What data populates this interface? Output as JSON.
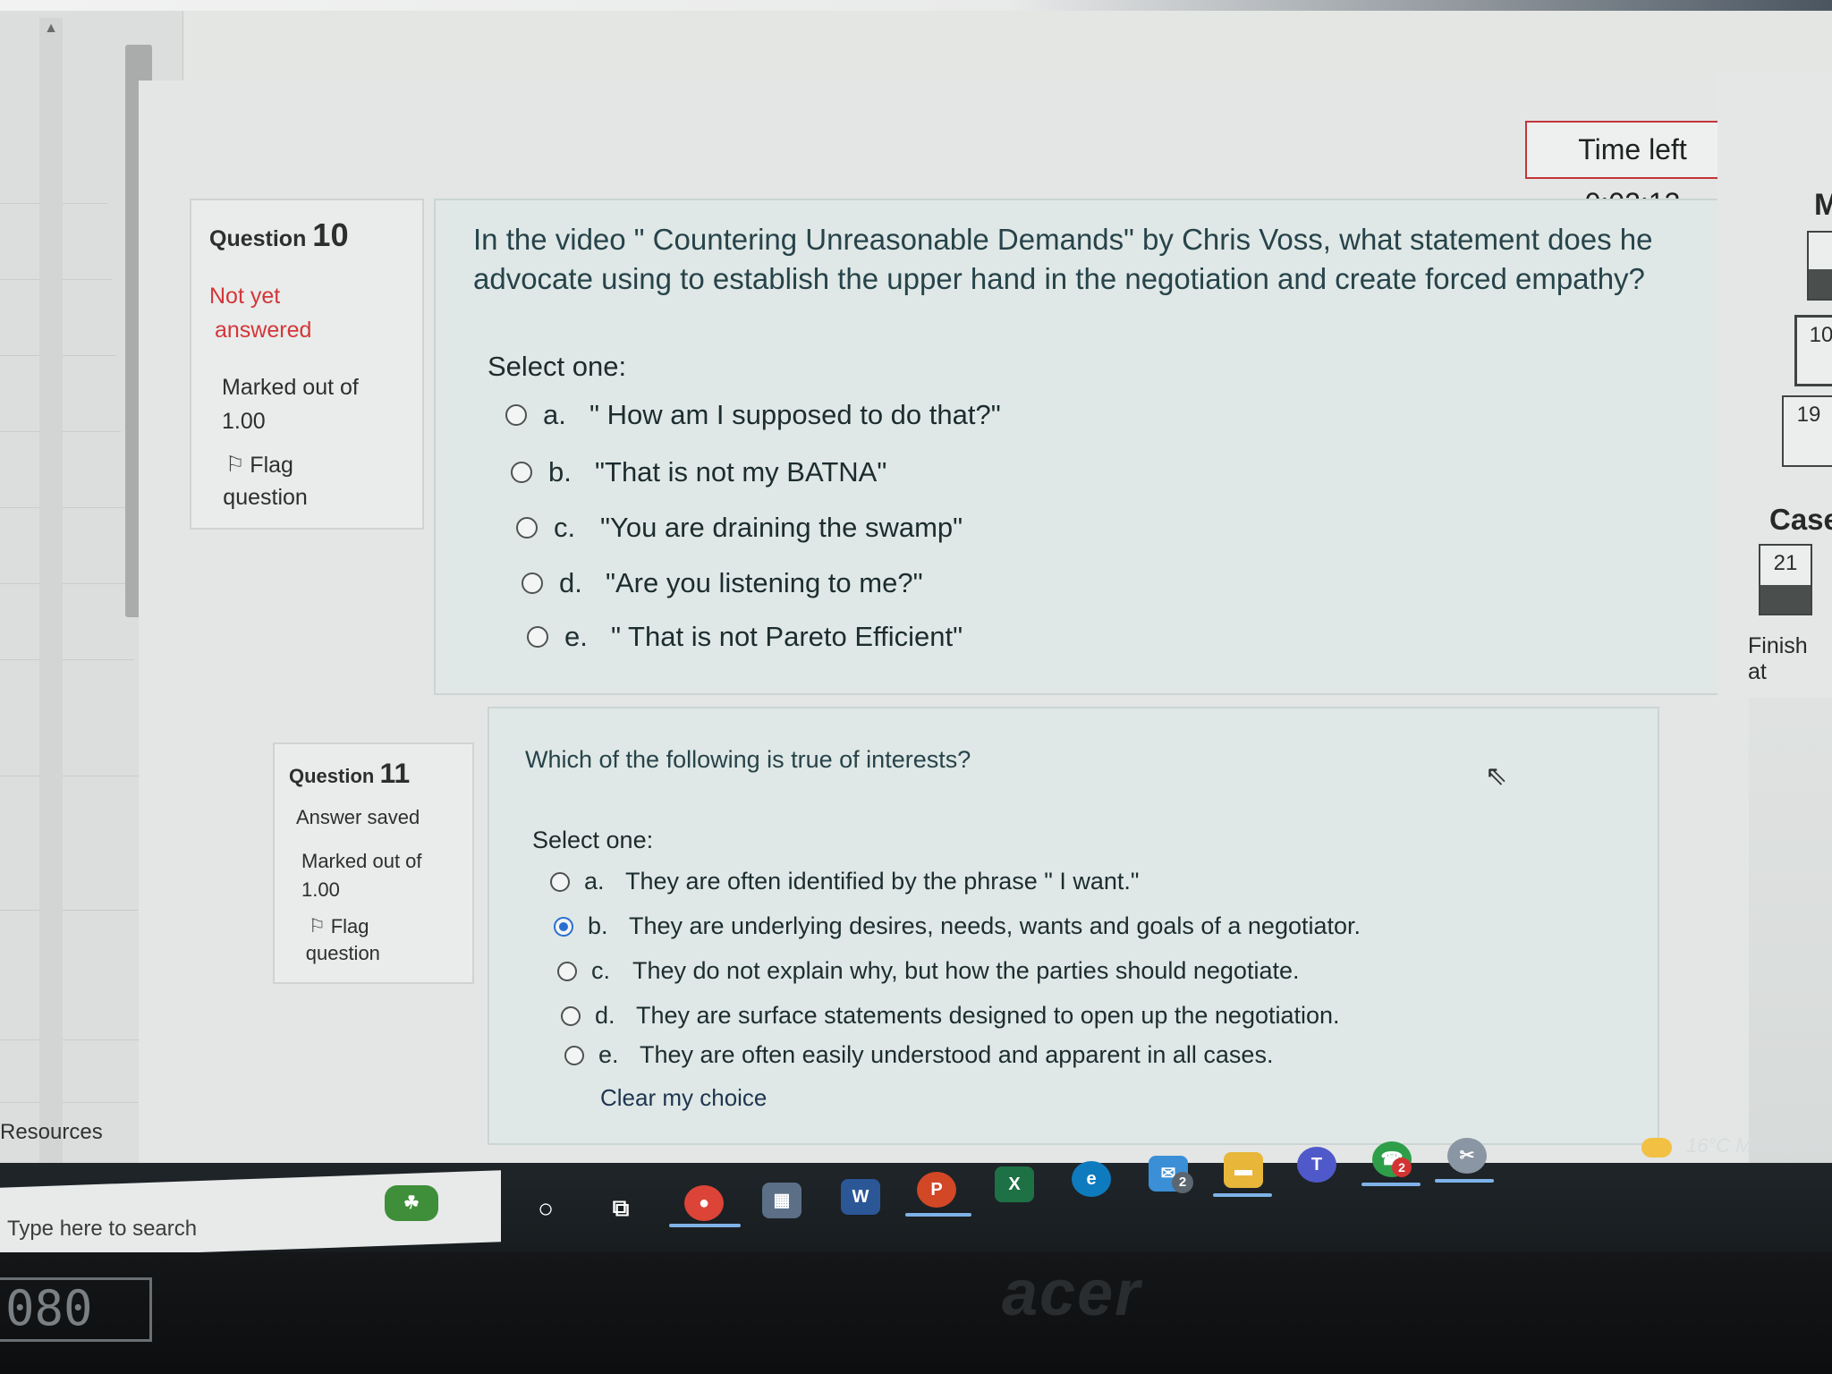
{
  "timer": {
    "label": "Time left 0:02:13"
  },
  "left_drawer": {
    "resources_label": "Resources"
  },
  "question10": {
    "title_prefix": "Question",
    "number": "10",
    "state_line1": "Not yet",
    "state_line2": "answered",
    "marked_line1": "Marked out of",
    "marked_line2": "1.00",
    "flag_line1": "Flag",
    "flag_line2": "question",
    "prompt": "In the video \" Countering Unreasonable Demands\" by Chris Voss, what statement does he advocate using to establish the upper hand in the negotiation and create forced empathy?",
    "select_label": "Select one:",
    "options": [
      {
        "letter": "a.",
        "text": "\" How am I supposed to do that?\"",
        "selected": false
      },
      {
        "letter": "b.",
        "text": "\"That is not my BATNA\"",
        "selected": false
      },
      {
        "letter": "c.",
        "text": "\"You are draining the swamp\"",
        "selected": false
      },
      {
        "letter": "d.",
        "text": "\"Are you listening to me?\"",
        "selected": false
      },
      {
        "letter": "e.",
        "text": "\" That is not Pareto Efficient\"",
        "selected": false
      }
    ]
  },
  "question11": {
    "title_prefix": "Question",
    "number": "11",
    "state": "Answer saved",
    "marked_line1": "Marked out of",
    "marked_line2": "1.00",
    "flag_line1": "Flag",
    "flag_line2": "question",
    "prompt": "Which of the following is true of interests?",
    "select_label": "Select one:",
    "options": [
      {
        "letter": "a.",
        "text": "They are often identified by the phrase \" I want.\"",
        "selected": false
      },
      {
        "letter": "b.",
        "text": "They are underlying desires, needs, wants and goals of a negotiator.",
        "selected": true
      },
      {
        "letter": "c.",
        "text": "They do not explain why, but how the parties should negotiate.",
        "selected": false
      },
      {
        "letter": "d.",
        "text": "They are surface statements designed to open up the negotiation.",
        "selected": false
      },
      {
        "letter": "e.",
        "text": "They are often easily understood and apparent in all cases.",
        "selected": false
      }
    ],
    "clear_label": "Clear my choice"
  },
  "right_drawer": {
    "heading": "M",
    "nav_10": "10",
    "nav_19": "19",
    "case_label": "Case",
    "nav_21": "21",
    "finish_label": "Finish at"
  },
  "taskbar": {
    "search_placeholder": "Type here to search",
    "weather": "16°C  Mostly clo",
    "mail_badge": "2",
    "chat_badge": "2"
  },
  "bezel": {
    "brand": "acer",
    "sticker": "080"
  },
  "colors": {
    "timer_border": "#c2353a",
    "not_answered_red": "#d4363a",
    "radio_selected": "#2a6fd0",
    "taskbar_bg": "#1f2529"
  }
}
